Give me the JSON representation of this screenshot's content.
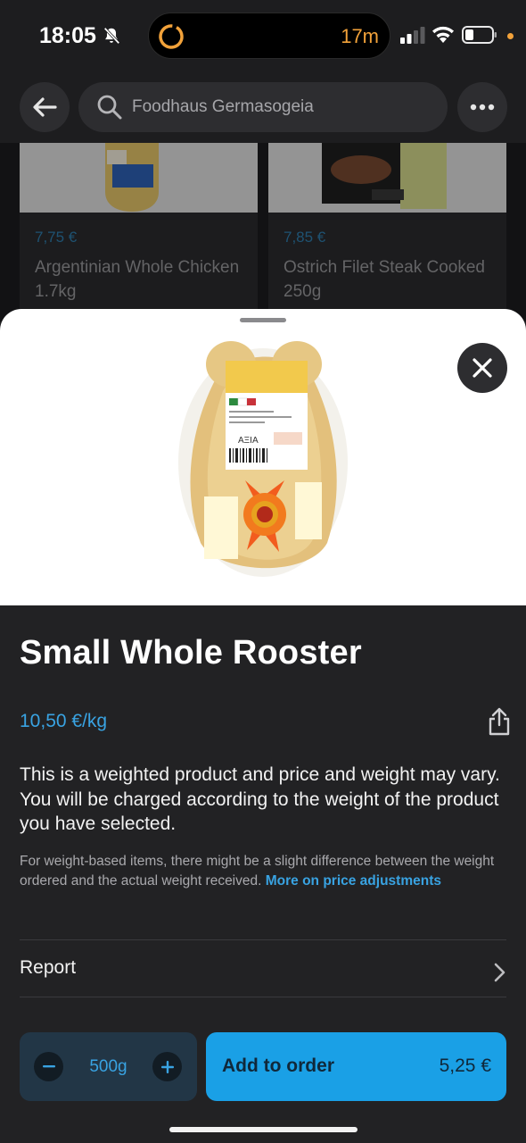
{
  "status_bar": {
    "time": "18:05",
    "timer": "17m"
  },
  "header": {
    "search_text": "Foodhaus Germasogeia"
  },
  "background_cards": [
    {
      "price": "7,75 €",
      "name": "Argentinian Whole Chicken 1.7kg"
    },
    {
      "price": "7,85 €",
      "name": "Ostrich Filet Steak Cooked 250g"
    }
  ],
  "product": {
    "title": "Small Whole Rooster",
    "unit_price": "10,50 €/kg",
    "description": "This is a weighted product and price and weight may vary. You will be charged according to the weight of the product you have selected.",
    "note": "For weight-based items, there might be a slight difference between the weight ordered and the actual weight received.",
    "note_link": "More on price adjustments",
    "label_text": "ΑΞΙΑ"
  },
  "report": {
    "label": "Report"
  },
  "order": {
    "quantity": "500g",
    "add_label": "Add to order",
    "total": "5,25 €"
  },
  "colors": {
    "accent": "#39a3e2",
    "button": "#1aa0e6",
    "timer": "#f2a23a"
  },
  "icons": [
    "bell-slash-icon",
    "timer-icon",
    "signal-icon",
    "wifi-icon",
    "battery-icon",
    "back-arrow-icon",
    "search-icon",
    "more-icon",
    "close-icon",
    "share-icon",
    "chevron-right-icon",
    "minus-icon",
    "plus-icon"
  ]
}
